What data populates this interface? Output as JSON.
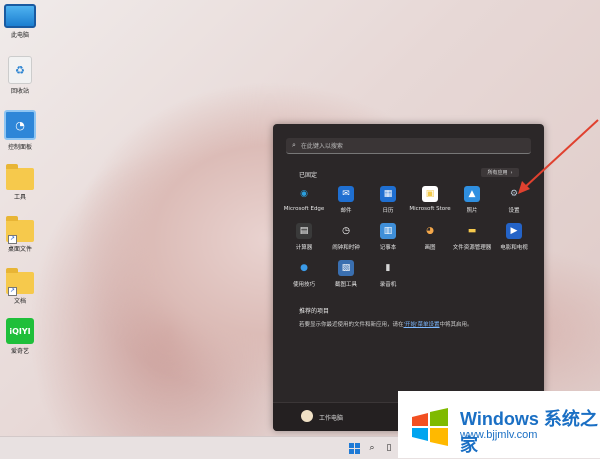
{
  "desktop": {
    "icons": [
      {
        "label": "此电脑"
      },
      {
        "label": "回收站"
      },
      {
        "label": "控制面板"
      },
      {
        "label": "工具"
      },
      {
        "label": "桌面文件"
      },
      {
        "label": "文档"
      },
      {
        "label": "爱奇艺",
        "logo_text": "iQIYI"
      }
    ]
  },
  "start_menu": {
    "search_placeholder": "在此键入以搜索",
    "pinned_title": "已固定",
    "all_apps_label": "所有应用",
    "all_apps_chevron": "›",
    "apps": [
      {
        "label": "Microsoft Edge",
        "icon": "edge-icon",
        "glyph": "◉",
        "color": "#2aa0e0",
        "bg": "transparent"
      },
      {
        "label": "邮件",
        "icon": "mail-icon",
        "glyph": "✉",
        "color": "#ffffff",
        "bg": "#1f6fd1"
      },
      {
        "label": "日历",
        "icon": "calendar-icon",
        "glyph": "▦",
        "color": "#ffffff",
        "bg": "#1f6fd1"
      },
      {
        "label": "Microsoft Store",
        "icon": "store-icon",
        "glyph": "▣",
        "color": "#f2c94c",
        "bg": "#ffffff"
      },
      {
        "label": "照片",
        "icon": "photos-icon",
        "glyph": "▲",
        "color": "#ffffff",
        "bg": "#2f8fe0"
      },
      {
        "label": "设置",
        "icon": "settings-gear-icon",
        "glyph": "⚙",
        "color": "#b9c7d6",
        "bg": "transparent"
      },
      {
        "label": "计算器",
        "icon": "calculator-icon",
        "glyph": "▤",
        "color": "#ffffff",
        "bg": "#3a3a3a"
      },
      {
        "label": "闹钟和时钟",
        "icon": "alarm-clock-icon",
        "glyph": "◷",
        "color": "#ffffff",
        "bg": "transparent"
      },
      {
        "label": "记事本",
        "icon": "notepad-icon",
        "glyph": "▥",
        "color": "#ffffff",
        "bg": "#3f8fd8"
      },
      {
        "label": "画图",
        "icon": "paint-icon",
        "glyph": "◕",
        "color": "#f4a74a",
        "bg": "transparent"
      },
      {
        "label": "文件资源管理器",
        "icon": "file-explorer-icon",
        "glyph": "▬",
        "color": "#f6c94c",
        "bg": "transparent"
      },
      {
        "label": "电影和电视",
        "icon": "movies-tv-icon",
        "glyph": "▶",
        "color": "#ffffff",
        "bg": "#2463c7"
      },
      {
        "label": "使用技巧",
        "icon": "tips-icon",
        "glyph": "●",
        "color": "#3b9be8",
        "bg": "transparent"
      },
      {
        "label": "截图工具",
        "icon": "snipping-tool-icon",
        "glyph": "▧",
        "color": "#ffffff",
        "bg": "#3a6fb0"
      },
      {
        "label": "录音机",
        "icon": "voice-recorder-icon",
        "glyph": "▮",
        "color": "#d6d6d6",
        "bg": "transparent"
      }
    ],
    "recommended_title": "推荐的项目",
    "recommended_text": "若要显示你最近使用的文件和新应用，请在",
    "recommended_link": "'开始'菜单设置",
    "recommended_text_end": "中将其启用。",
    "user_name": "工作电脑"
  },
  "watermark": {
    "title": "Windows 系统之家",
    "url": "www.bjjmlv.com"
  },
  "colors": {
    "menu_bg": "#2b2728",
    "annotation_arrow": "#e0412f",
    "watermark_blue": "#1a6fc4"
  }
}
